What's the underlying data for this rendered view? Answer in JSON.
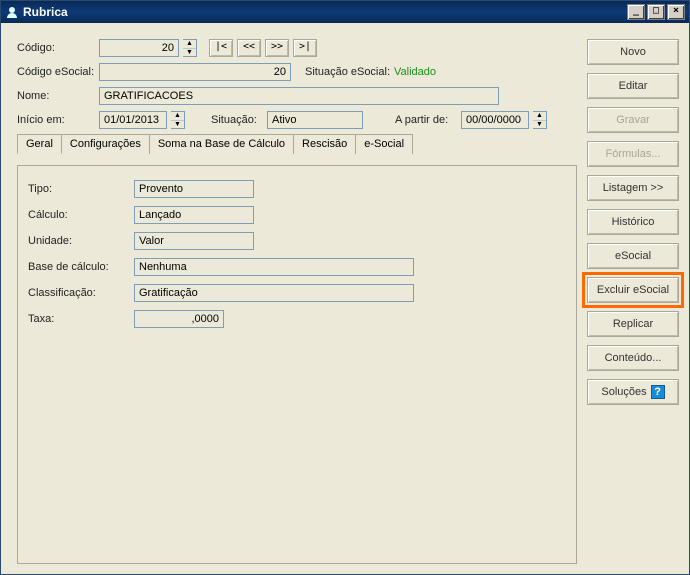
{
  "window": {
    "title": "Rubrica"
  },
  "winbuttons": {
    "min": "_",
    "max": "□",
    "close": "×"
  },
  "header": {
    "codigo_label": "Código:",
    "codigo_value": "20",
    "nav_first": "|<",
    "nav_prev": "<<",
    "nav_next": ">>",
    "nav_last": ">|",
    "codigo_esocial_label": "Código eSocial:",
    "codigo_esocial_value": "20",
    "situacao_esocial_label": "Situação eSocial:",
    "situacao_esocial_value": "Validado",
    "nome_label": "Nome:",
    "nome_value": "GRATIFICACOES",
    "inicio_label": "Início em:",
    "inicio_value": "01/01/2013",
    "situacao_label": "Situação:",
    "situacao_value": "Ativo",
    "a_partir_label": "A partir de:",
    "a_partir_value": "00/00/0000"
  },
  "tabs": [
    {
      "label": "Geral"
    },
    {
      "label": "Configurações"
    },
    {
      "label": "Soma na Base de Cálculo"
    },
    {
      "label": "Rescisão"
    },
    {
      "label": "e-Social"
    }
  ],
  "geral": {
    "tipo_label": "Tipo:",
    "tipo_value": "Provento",
    "calculo_label": "Cálculo:",
    "calculo_value": "Lançado",
    "unidade_label": "Unidade:",
    "unidade_value": "Valor",
    "base_label": "Base de cálculo:",
    "base_value": "Nenhuma",
    "class_label": "Classificação:",
    "class_value": "Gratificação",
    "taxa_label": "Taxa:",
    "taxa_value": ",0000"
  },
  "sidebar": {
    "novo": "Novo",
    "editar": "Editar",
    "gravar": "Gravar",
    "formulas": "Fórmulas...",
    "listagem": "Listagem >>",
    "historico": "Histórico",
    "esocial": "eSocial",
    "excluir_esocial": "Excluir eSocial",
    "replicar": "Replicar",
    "conteudo": "Conteúdo...",
    "solucoes": "Soluções"
  }
}
